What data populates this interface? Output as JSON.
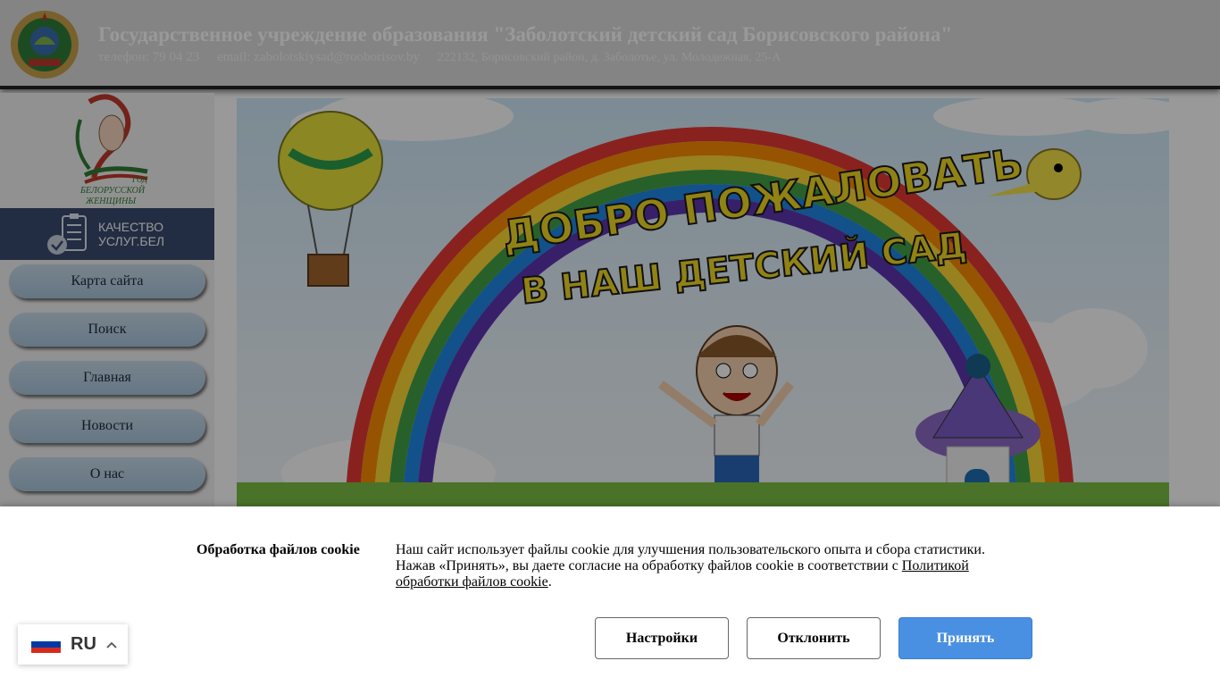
{
  "header": {
    "title": "Государственное учреждение образования \"Заболотский детский сад Борисовского района\"",
    "phone": "телефон: 79 04 23",
    "email": "email: zabolotskiysad@rooborisov.by",
    "address": "222132, Борисовский район, д. Заболотье, ул. Молодежная, 25-А"
  },
  "sidebar": {
    "year_logo": {
      "line1": "ГОД",
      "line2": "БЕЛОРУССКОЙ",
      "line3": "ЖЕНЩИНЫ"
    },
    "kachestvo": {
      "line1": "КАЧЕСТВО",
      "line2": "УСЛУГ.БЕЛ"
    },
    "menu": [
      {
        "label": "Карта сайта"
      },
      {
        "label": "Поиск"
      },
      {
        "label": "Главная"
      },
      {
        "label": "Новости"
      },
      {
        "label": "О нас"
      }
    ]
  },
  "banner": {
    "line1": "ДОБРО ПОЖАЛОВАТЬ",
    "line2": "В НАШ ДЕТСКИЙ САД"
  },
  "cookie": {
    "title": "Обработка файлов cookie",
    "text_line1": "Наш сайт использует файлы cookie для улучшения пользовательского опыта и сбора статистики.",
    "text_line2": "Нажав «Принять», вы даете согласие на обработку файлов cookie в соответствии с ",
    "policy_link": "Политикой обработки файлов cookie",
    "text_end": ".",
    "buttons": {
      "settings": "Настройки",
      "decline": "Отклонить",
      "accept": "Принять"
    }
  },
  "language": {
    "code": "RU",
    "icon": "flag-ru-icon",
    "flag_colors": [
      "#ffffff",
      "#0039a6",
      "#d52b1e"
    ]
  },
  "colors": {
    "accent": "#4a90e2",
    "kachestvo_bg": "#3a4a6e",
    "menu_bg": "#b9d2e4"
  }
}
